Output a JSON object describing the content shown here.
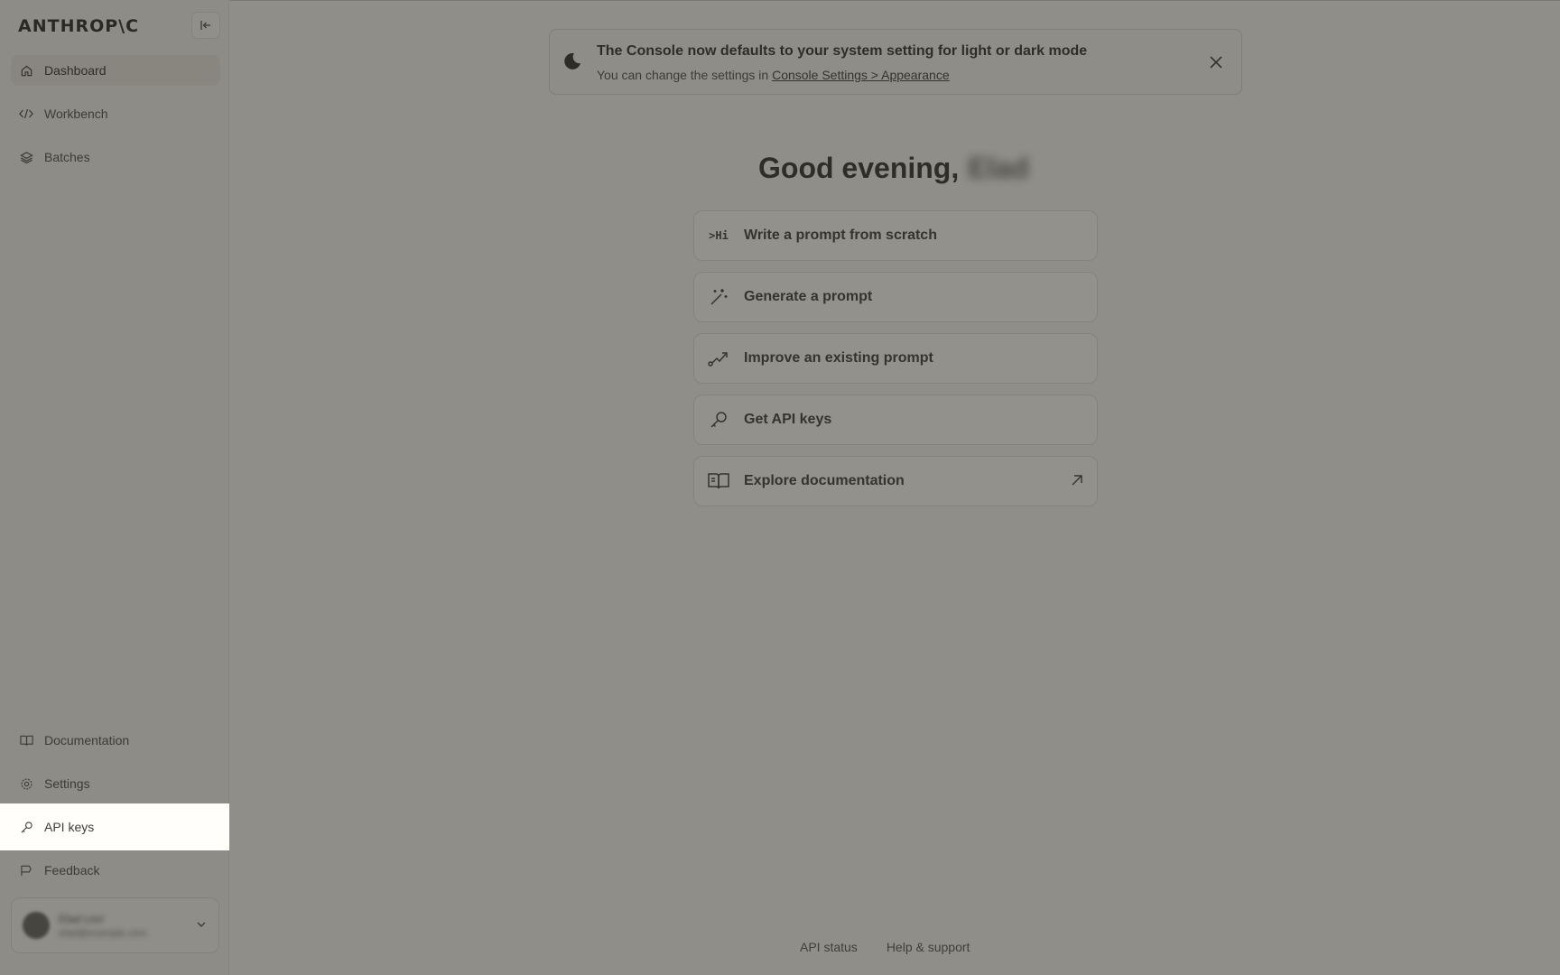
{
  "sidebar": {
    "logo": "ANTHROP\\C",
    "nav": [
      {
        "label": "Dashboard",
        "icon": "home-icon"
      },
      {
        "label": "Workbench",
        "icon": "code-icon"
      },
      {
        "label": "Batches",
        "icon": "layers-icon"
      }
    ],
    "bottom_nav": [
      {
        "label": "Documentation",
        "icon": "book-icon"
      },
      {
        "label": "Settings",
        "icon": "gear-icon"
      },
      {
        "label": "API keys",
        "icon": "key-icon"
      },
      {
        "label": "Feedback",
        "icon": "feedback-icon"
      }
    ],
    "account": {
      "name": "Elad Levi",
      "email": "elad@example.com"
    }
  },
  "banner": {
    "title": "The Console now defaults to your system setting for light or dark mode",
    "sub_prefix": "You can change the settings in ",
    "link": "Console Settings > Appearance"
  },
  "greeting": {
    "text": "Good evening,",
    "name": "Elad"
  },
  "actions": [
    {
      "label": "Write a prompt from scratch",
      "icon": ">Hi"
    },
    {
      "label": "Generate a prompt",
      "icon": "magic-wand-icon"
    },
    {
      "label": "Improve an existing prompt",
      "icon": "trend-icon"
    },
    {
      "label": "Get API keys",
      "icon": "key-icon"
    },
    {
      "label": "Explore documentation",
      "icon": "book-icon"
    }
  ],
  "footer": {
    "api_status": "API status",
    "help": "Help & support"
  },
  "colors": {
    "page_bg": "#f5f4ef",
    "sidebar_bg": "#f0efe9",
    "dim_overlay": "rgba(60,58,52,0.55)",
    "highlight": "#fffefb"
  }
}
